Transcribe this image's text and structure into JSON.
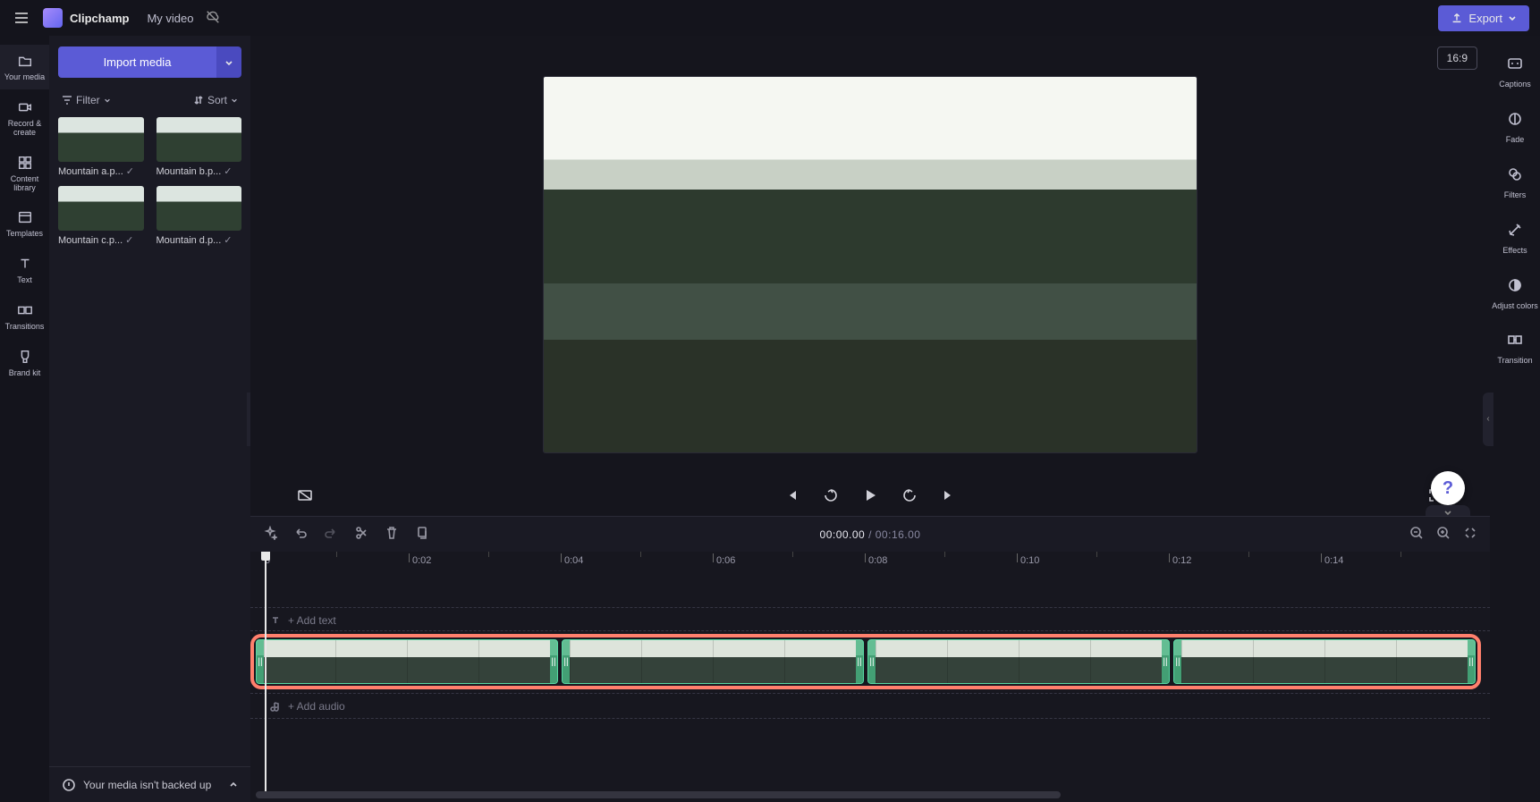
{
  "app": {
    "brand": "Clipchamp",
    "project_title": "My video"
  },
  "export_button": "Export",
  "aspect_ratio": "16:9",
  "left_rail": [
    {
      "id": "your-media",
      "label": "Your media"
    },
    {
      "id": "record-create",
      "label": "Record & create"
    },
    {
      "id": "content-library",
      "label": "Content library"
    },
    {
      "id": "templates",
      "label": "Templates"
    },
    {
      "id": "text",
      "label": "Text"
    },
    {
      "id": "transitions",
      "label": "Transitions"
    },
    {
      "id": "brand-kit",
      "label": "Brand kit"
    }
  ],
  "media_panel": {
    "import_label": "Import media",
    "filter_label": "Filter",
    "sort_label": "Sort",
    "items": [
      {
        "name": "Mountain a.p..."
      },
      {
        "name": "Mountain b.p..."
      },
      {
        "name": "Mountain c.p..."
      },
      {
        "name": "Mountain d.p..."
      }
    ],
    "backup_notice": "Your media isn't backed up"
  },
  "right_rail": [
    {
      "id": "captions",
      "label": "Captions"
    },
    {
      "id": "fade",
      "label": "Fade"
    },
    {
      "id": "filters",
      "label": "Filters"
    },
    {
      "id": "effects",
      "label": "Effects"
    },
    {
      "id": "adjust-colors",
      "label": "Adjust colors"
    },
    {
      "id": "transition",
      "label": "Transition"
    }
  ],
  "playback": {
    "current_time": "00:00.00",
    "separator": " / ",
    "duration": "00:16.00"
  },
  "timeline": {
    "ruler_start": "0",
    "ticks": [
      "0:02",
      "0:04",
      "0:06",
      "0:08",
      "0:10",
      "0:12",
      "0:14"
    ],
    "add_text_label": "+ Add text",
    "add_audio_label": "+ Add audio",
    "clips": [
      {
        "source": "Mountain a"
      },
      {
        "source": "Mountain b"
      },
      {
        "source": "Mountain c"
      },
      {
        "source": "Mountain d"
      }
    ]
  },
  "help_label": "?"
}
